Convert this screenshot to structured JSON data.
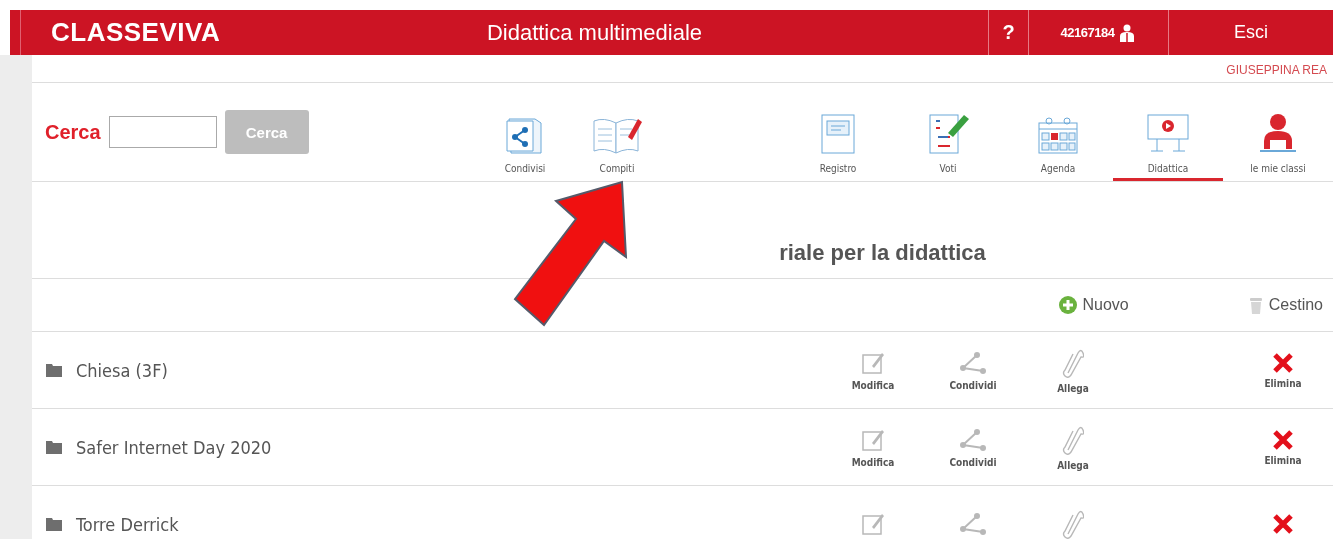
{
  "header": {
    "logo": "CLASSEVIVA",
    "title": "Didattica multimediale",
    "help": "?",
    "user_code": "42167184",
    "logout": "Esci"
  },
  "user_name": "GIUSEPPINA REA",
  "search": {
    "label": "Cerca",
    "button": "Cerca"
  },
  "nav": [
    {
      "kind": "shared",
      "label": "Condivisi",
      "selected": false
    },
    {
      "kind": "homework",
      "label": "Compiti",
      "selected": false
    },
    {
      "kind": "register",
      "label": "Registro",
      "selected": false
    },
    {
      "kind": "grades",
      "label": "Voti",
      "selected": false
    },
    {
      "kind": "agenda",
      "label": "Agenda",
      "selected": false
    },
    {
      "kind": "teaching",
      "label": "Didattica",
      "selected": true
    },
    {
      "kind": "classes",
      "label": "le mie classi",
      "selected": false
    }
  ],
  "heading": "riale per la didattica",
  "toolbar": {
    "new": "Nuovo",
    "trash": "Cestino"
  },
  "folders": [
    {
      "name": "Chiesa (3F)",
      "actions": [
        {
          "kind": "edit",
          "label": "Modifica"
        },
        {
          "kind": "share",
          "label": "Condividi"
        },
        {
          "kind": "attach",
          "label": "Allega"
        },
        {
          "kind": "delete",
          "label": "Elimina"
        }
      ]
    },
    {
      "name": "Safer Internet Day 2020",
      "actions": [
        {
          "kind": "edit",
          "label": "Modifica"
        },
        {
          "kind": "share",
          "label": "Condividi"
        },
        {
          "kind": "attach",
          "label": "Allega"
        },
        {
          "kind": "delete",
          "label": "Elimina"
        }
      ]
    },
    {
      "name": "Torre Derrick",
      "actions": [
        {
          "kind": "edit"
        },
        {
          "kind": "share"
        },
        {
          "kind": "attach"
        },
        {
          "kind": "delete"
        }
      ]
    }
  ]
}
